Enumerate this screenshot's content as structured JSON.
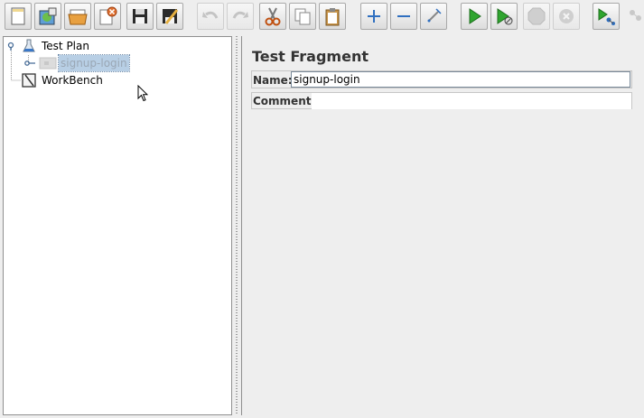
{
  "toolbar": {
    "buttons": [
      {
        "name": "new",
        "enabled": true
      },
      {
        "name": "templates",
        "enabled": true
      },
      {
        "name": "open",
        "enabled": true
      },
      {
        "name": "close",
        "enabled": true
      },
      {
        "name": "save",
        "enabled": true
      },
      {
        "name": "save-as",
        "enabled": true
      },
      {
        "name": "undo",
        "enabled": false
      },
      {
        "name": "redo",
        "enabled": false
      },
      {
        "name": "cut",
        "enabled": true
      },
      {
        "name": "copy",
        "enabled": true
      },
      {
        "name": "paste",
        "enabled": true
      },
      {
        "name": "expand",
        "enabled": true
      },
      {
        "name": "collapse",
        "enabled": true
      },
      {
        "name": "toggle",
        "enabled": true
      },
      {
        "name": "start",
        "enabled": true
      },
      {
        "name": "start-no-pauses",
        "enabled": true
      },
      {
        "name": "stop",
        "enabled": false
      },
      {
        "name": "shutdown",
        "enabled": false
      },
      {
        "name": "remote-start",
        "enabled": true
      },
      {
        "name": "remote-stop",
        "enabled": false
      }
    ]
  },
  "tree": {
    "items": [
      {
        "label": "Test Plan",
        "icon": "test-plan-icon"
      },
      {
        "label": "signup-login",
        "icon": "test-fragment-icon",
        "selected": true,
        "disabled": true
      },
      {
        "label": "WorkBench",
        "icon": "workbench-icon"
      }
    ]
  },
  "editor": {
    "title": "Test Fragment",
    "name_label": "Name:",
    "name_value": "signup-login",
    "comments_label": "Comments:",
    "comments_value": ""
  },
  "colors": {
    "selection": "#b8cfe5",
    "play_green": "#2fa52f",
    "add_blue": "#2f6fc0"
  }
}
